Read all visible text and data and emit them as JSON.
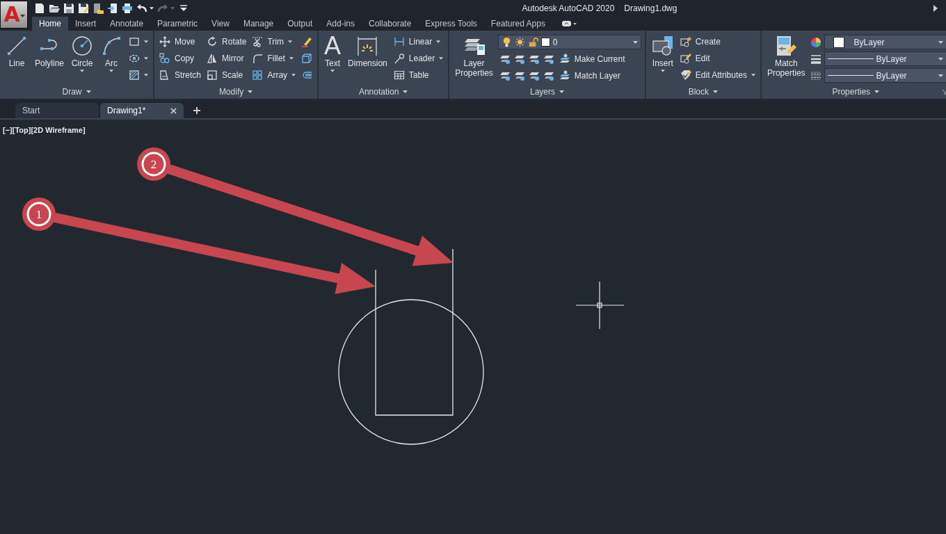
{
  "app_button": {
    "glyph": "A"
  },
  "quick_access": [
    {
      "disabled": false
    },
    {
      "disabled": false
    },
    {
      "disabled": false
    },
    {
      "disabled": false
    },
    {
      "disabled": false
    },
    {
      "disabled": false
    },
    {
      "disabled": false
    },
    {
      "disabled": false
    },
    {
      "disabled": true
    },
    {
      "disabled": false
    }
  ],
  "title": {
    "app": "Autodesk AutoCAD 2020",
    "document": "Drawing1.dwg"
  },
  "ribbon_tabs": [
    {
      "label": "Home",
      "selected": true
    },
    {
      "label": "Insert",
      "selected": false
    },
    {
      "label": "Annotate",
      "selected": false
    },
    {
      "label": "Parametric",
      "selected": false
    },
    {
      "label": "View",
      "selected": false
    },
    {
      "label": "Manage",
      "selected": false
    },
    {
      "label": "Output",
      "selected": false
    },
    {
      "label": "Add-ins",
      "selected": false
    },
    {
      "label": "Collaborate",
      "selected": false
    },
    {
      "label": "Express Tools",
      "selected": false
    },
    {
      "label": "Featured Apps",
      "selected": false
    }
  ],
  "panels": [
    {
      "title": "Draw",
      "menu": true,
      "items": [
        {
          "kind": "large",
          "label": "Line",
          "menu": false
        },
        {
          "kind": "large",
          "label": "Polyline",
          "menu": false
        },
        {
          "kind": "large",
          "label": "Circle",
          "menu": true
        },
        {
          "kind": "large",
          "label": "Arc",
          "menu": true
        },
        {
          "kind": "column",
          "tools": [
            {
              "menu": true
            },
            {
              "menu": true
            },
            {
              "menu": true
            }
          ]
        }
      ]
    },
    {
      "title": "Modify",
      "menu": true,
      "items": [
        {
          "kind": "column",
          "tools": [
            {
              "label": "Move",
              "menu": false
            },
            {
              "label": "Copy",
              "menu": false
            },
            {
              "label": "Stretch",
              "menu": false
            }
          ]
        },
        {
          "kind": "column",
          "tools": [
            {
              "label": "Rotate",
              "menu": false
            },
            {
              "label": "Mirror",
              "menu": false
            },
            {
              "label": "Scale",
              "menu": false
            }
          ]
        },
        {
          "kind": "column",
          "tools": [
            {
              "label": "Trim",
              "menu": true
            },
            {
              "label": "Fillet",
              "menu": true
            },
            {
              "label": "Array",
              "menu": true
            }
          ]
        },
        {
          "kind": "column",
          "tools": [
            {
              "menu": false
            },
            {
              "menu": false
            },
            {
              "menu": false
            }
          ]
        }
      ]
    },
    {
      "title": "Annotation",
      "menu": true,
      "items": [
        {
          "kind": "large",
          "label": "Text",
          "glyph": "A",
          "menu": true
        },
        {
          "kind": "large",
          "label": "Dimension",
          "menu": false
        },
        {
          "kind": "column",
          "tools": [
            {
              "label": "Linear",
              "menu": true
            },
            {
              "label": "Leader",
              "menu": true
            },
            {
              "label": "Table",
              "menu": false
            }
          ]
        }
      ]
    },
    {
      "title": "Layers",
      "menu": true,
      "items": [
        {
          "kind": "large",
          "label": "Layer Properties",
          "menu": false
        },
        {
          "kind": "layers",
          "layer": "0",
          "tools": [
            {
              "label": "Make Current"
            },
            {
              "label": "Match Layer"
            }
          ]
        }
      ]
    },
    {
      "title": "Block",
      "menu": true,
      "items": [
        {
          "kind": "large",
          "label": "Insert",
          "menu": true
        },
        {
          "kind": "column",
          "tools": [
            {
              "label": "Create",
              "menu": false
            },
            {
              "label": "Edit",
              "menu": false
            },
            {
              "label": "Edit Attributes",
              "menu": true
            }
          ]
        }
      ]
    },
    {
      "title": "Properties",
      "menu": true,
      "items": [
        {
          "kind": "large",
          "label": "Match Properties",
          "menu": false
        },
        {
          "kind": "properties",
          "rows": [
            {
              "kind": "color",
              "value": "ByLayer"
            },
            {
              "kind": "lineweight",
              "value": "ByLayer"
            },
            {
              "kind": "linetype",
              "value": "ByLayer"
            }
          ]
        }
      ]
    }
  ],
  "document_tabs": [
    {
      "label": "Start",
      "selected": false,
      "closable": false
    },
    {
      "label": "Drawing1*",
      "selected": true,
      "closable": true
    }
  ],
  "viewport_label": "[−][Top][2D Wireframe]",
  "callouts": [
    {
      "number": "1"
    },
    {
      "number": "2"
    }
  ]
}
